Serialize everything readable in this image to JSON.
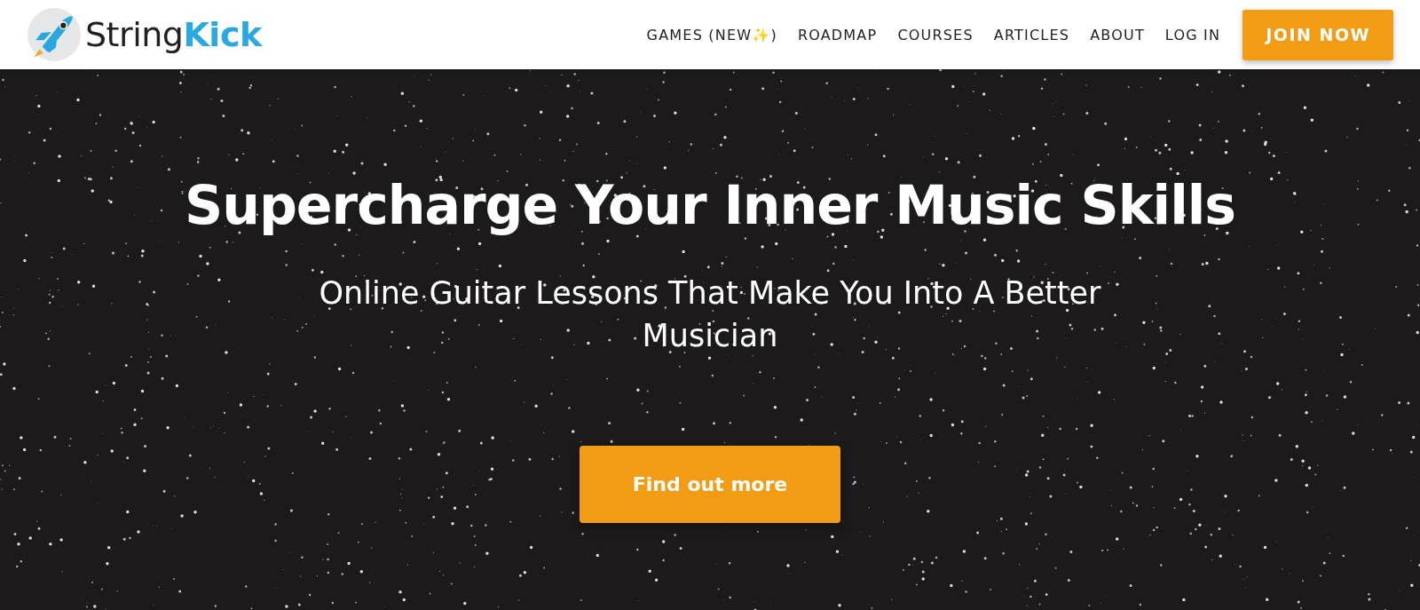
{
  "header": {
    "logo": {
      "part_1": "String",
      "part_2": "Kick"
    },
    "nav": [
      {
        "label": "GAMES (NEW✨)"
      },
      {
        "label": "ROADMAP"
      },
      {
        "label": "COURSES"
      },
      {
        "label": "ARTICLES"
      },
      {
        "label": "ABOUT"
      },
      {
        "label": "LOG IN"
      }
    ],
    "cta": "JOIN NOW"
  },
  "hero": {
    "title": "Supercharge Your Inner Music Skills",
    "subtitle": "Online Guitar Lessons That Make You Into A Better Musician",
    "button": "Find out more"
  }
}
